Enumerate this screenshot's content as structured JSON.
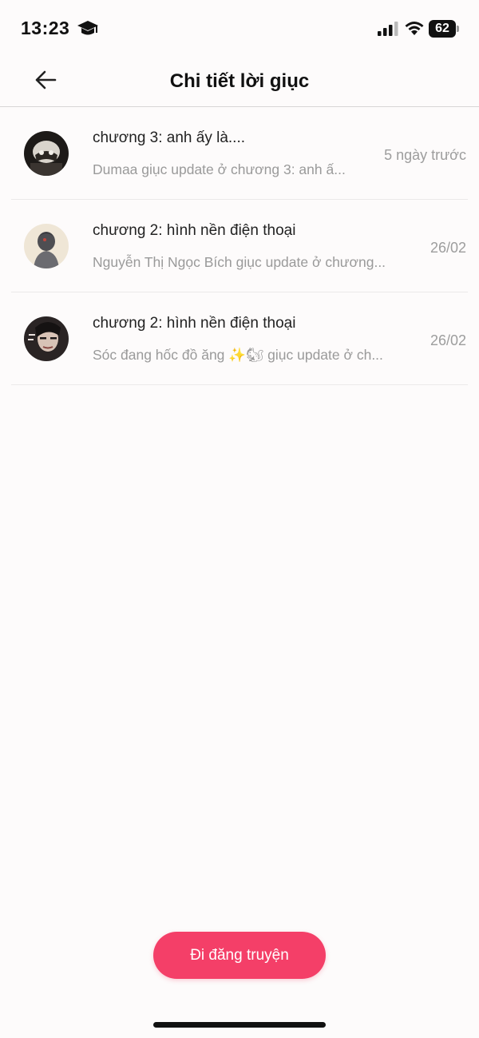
{
  "status_bar": {
    "time": "13:23",
    "battery": "62"
  },
  "header": {
    "title": "Chi tiết lời giục"
  },
  "items": [
    {
      "title": "chương 3: anh ấy là....",
      "subtitle": "Dumaa giục update ở chương 3: anh ấ...",
      "time": "5 ngày trước"
    },
    {
      "title": "chương 2: hình nền điện thoại",
      "subtitle": "Nguyễn Thị Ngọc Bích giục update ở chương...",
      "time": "26/02"
    },
    {
      "title": "chương 2: hình nền điện thoại",
      "subtitle": "Sóc đang hốc đồ ăng ✨🐿 giục update ở ch...",
      "time": "26/02"
    }
  ],
  "footer": {
    "post_label": "Đi đăng truyện"
  },
  "colors": {
    "accent": "#f43f68",
    "background": "#fdfbfb",
    "muted_text": "#9a9a9a"
  }
}
